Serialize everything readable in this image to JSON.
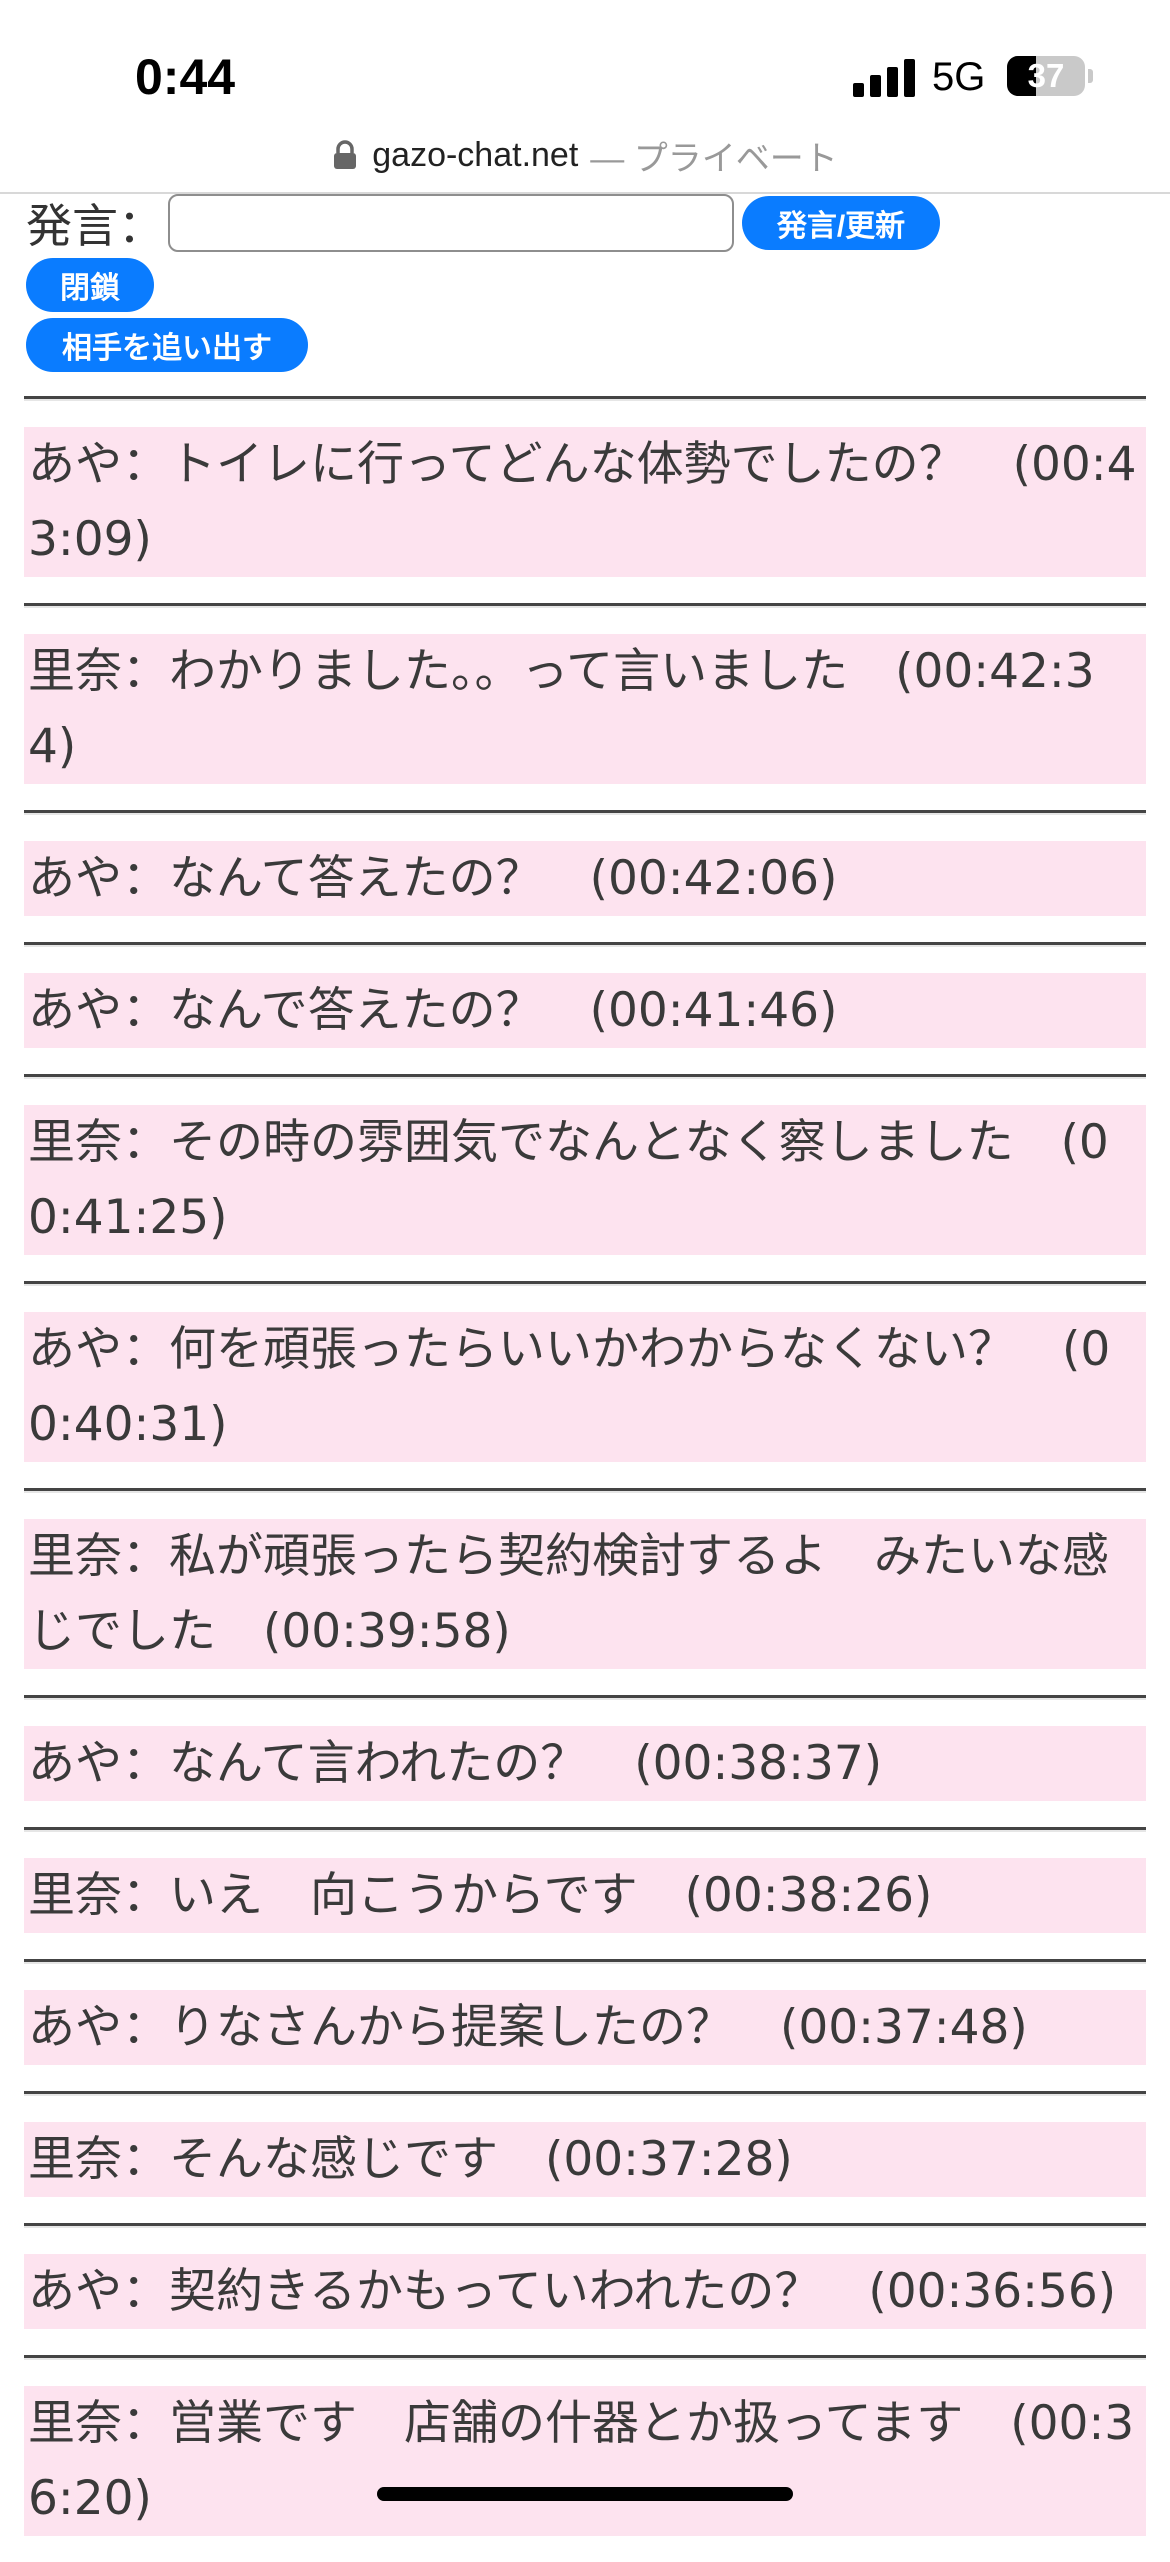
{
  "status_bar": {
    "time": "0:44",
    "network": "5G",
    "battery_percent": "37",
    "battery_level": 0.37
  },
  "url_bar": {
    "domain": "gazo-chat.net",
    "mode": "— プライベート",
    "icon": "lock-icon"
  },
  "form": {
    "label": "発言：",
    "input_value": "",
    "send_button": "発言/更新",
    "close_button": "閉鎖",
    "kick_button": "相手を追い出す"
  },
  "messages": [
    {
      "text": "あや：トイレに行ってどんな体勢でしたの？　(00:43:09)"
    },
    {
      "text": "里奈：わかりました。。って言いました　(00:42:34)"
    },
    {
      "text": "あや：なんて答えたの？　(00:42:06)"
    },
    {
      "text": "あや：なんで答えたの？　(00:41:46)"
    },
    {
      "text": "里奈：その時の雰囲気でなんとなく察しました　(00:41:25)"
    },
    {
      "text": "あや：何を頑張ったらいいかわからなくない？　(00:40:31)"
    },
    {
      "text": "里奈：私が頑張ったら契約検討するよ　みたいな感じでした　(00:39:58)"
    },
    {
      "text": "あや：なんて言われたの？　(00:38:37)"
    },
    {
      "text": "里奈：いえ　向こうからです　(00:38:26)"
    },
    {
      "text": "あや：りなさんから提案したの？　(00:37:48)"
    },
    {
      "text": "里奈：そんな感じです　(00:37:28)"
    },
    {
      "text": "あや：契約きるかもっていわれたの？　(00:36:56)"
    },
    {
      "text": "里奈：営業です　店舗の什器とか扱ってます　(00:36:20)"
    }
  ],
  "colors": {
    "accent": "#0a7cff",
    "message_bg": "#fde3ef"
  }
}
